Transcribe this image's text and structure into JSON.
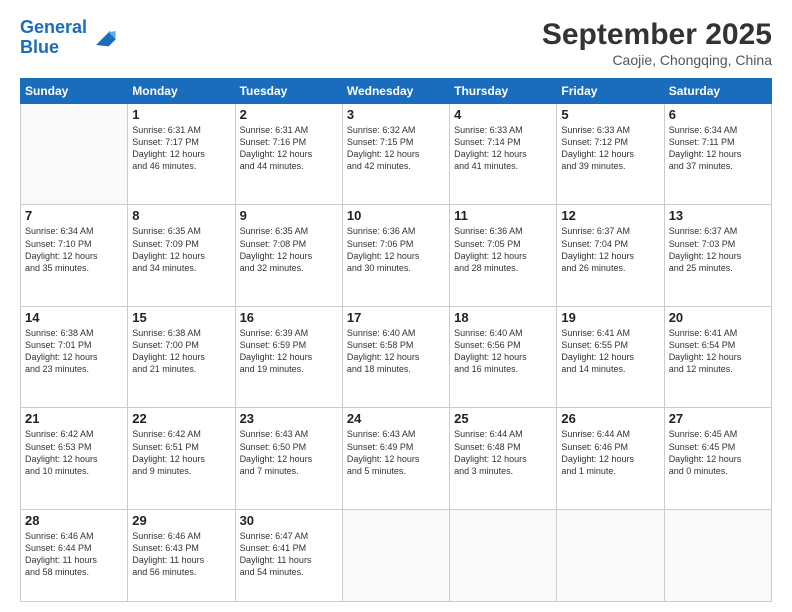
{
  "header": {
    "logo_line1": "General",
    "logo_line2": "Blue",
    "month": "September 2025",
    "location": "Caojie, Chongqing, China"
  },
  "weekdays": [
    "Sunday",
    "Monday",
    "Tuesday",
    "Wednesday",
    "Thursday",
    "Friday",
    "Saturday"
  ],
  "weeks": [
    [
      {
        "day": "",
        "info": ""
      },
      {
        "day": "1",
        "info": "Sunrise: 6:31 AM\nSunset: 7:17 PM\nDaylight: 12 hours\nand 46 minutes."
      },
      {
        "day": "2",
        "info": "Sunrise: 6:31 AM\nSunset: 7:16 PM\nDaylight: 12 hours\nand 44 minutes."
      },
      {
        "day": "3",
        "info": "Sunrise: 6:32 AM\nSunset: 7:15 PM\nDaylight: 12 hours\nand 42 minutes."
      },
      {
        "day": "4",
        "info": "Sunrise: 6:33 AM\nSunset: 7:14 PM\nDaylight: 12 hours\nand 41 minutes."
      },
      {
        "day": "5",
        "info": "Sunrise: 6:33 AM\nSunset: 7:12 PM\nDaylight: 12 hours\nand 39 minutes."
      },
      {
        "day": "6",
        "info": "Sunrise: 6:34 AM\nSunset: 7:11 PM\nDaylight: 12 hours\nand 37 minutes."
      }
    ],
    [
      {
        "day": "7",
        "info": "Sunrise: 6:34 AM\nSunset: 7:10 PM\nDaylight: 12 hours\nand 35 minutes."
      },
      {
        "day": "8",
        "info": "Sunrise: 6:35 AM\nSunset: 7:09 PM\nDaylight: 12 hours\nand 34 minutes."
      },
      {
        "day": "9",
        "info": "Sunrise: 6:35 AM\nSunset: 7:08 PM\nDaylight: 12 hours\nand 32 minutes."
      },
      {
        "day": "10",
        "info": "Sunrise: 6:36 AM\nSunset: 7:06 PM\nDaylight: 12 hours\nand 30 minutes."
      },
      {
        "day": "11",
        "info": "Sunrise: 6:36 AM\nSunset: 7:05 PM\nDaylight: 12 hours\nand 28 minutes."
      },
      {
        "day": "12",
        "info": "Sunrise: 6:37 AM\nSunset: 7:04 PM\nDaylight: 12 hours\nand 26 minutes."
      },
      {
        "day": "13",
        "info": "Sunrise: 6:37 AM\nSunset: 7:03 PM\nDaylight: 12 hours\nand 25 minutes."
      }
    ],
    [
      {
        "day": "14",
        "info": "Sunrise: 6:38 AM\nSunset: 7:01 PM\nDaylight: 12 hours\nand 23 minutes."
      },
      {
        "day": "15",
        "info": "Sunrise: 6:38 AM\nSunset: 7:00 PM\nDaylight: 12 hours\nand 21 minutes."
      },
      {
        "day": "16",
        "info": "Sunrise: 6:39 AM\nSunset: 6:59 PM\nDaylight: 12 hours\nand 19 minutes."
      },
      {
        "day": "17",
        "info": "Sunrise: 6:40 AM\nSunset: 6:58 PM\nDaylight: 12 hours\nand 18 minutes."
      },
      {
        "day": "18",
        "info": "Sunrise: 6:40 AM\nSunset: 6:56 PM\nDaylight: 12 hours\nand 16 minutes."
      },
      {
        "day": "19",
        "info": "Sunrise: 6:41 AM\nSunset: 6:55 PM\nDaylight: 12 hours\nand 14 minutes."
      },
      {
        "day": "20",
        "info": "Sunrise: 6:41 AM\nSunset: 6:54 PM\nDaylight: 12 hours\nand 12 minutes."
      }
    ],
    [
      {
        "day": "21",
        "info": "Sunrise: 6:42 AM\nSunset: 6:53 PM\nDaylight: 12 hours\nand 10 minutes."
      },
      {
        "day": "22",
        "info": "Sunrise: 6:42 AM\nSunset: 6:51 PM\nDaylight: 12 hours\nand 9 minutes."
      },
      {
        "day": "23",
        "info": "Sunrise: 6:43 AM\nSunset: 6:50 PM\nDaylight: 12 hours\nand 7 minutes."
      },
      {
        "day": "24",
        "info": "Sunrise: 6:43 AM\nSunset: 6:49 PM\nDaylight: 12 hours\nand 5 minutes."
      },
      {
        "day": "25",
        "info": "Sunrise: 6:44 AM\nSunset: 6:48 PM\nDaylight: 12 hours\nand 3 minutes."
      },
      {
        "day": "26",
        "info": "Sunrise: 6:44 AM\nSunset: 6:46 PM\nDaylight: 12 hours\nand 1 minute."
      },
      {
        "day": "27",
        "info": "Sunrise: 6:45 AM\nSunset: 6:45 PM\nDaylight: 12 hours\nand 0 minutes."
      }
    ],
    [
      {
        "day": "28",
        "info": "Sunrise: 6:46 AM\nSunset: 6:44 PM\nDaylight: 11 hours\nand 58 minutes."
      },
      {
        "day": "29",
        "info": "Sunrise: 6:46 AM\nSunset: 6:43 PM\nDaylight: 11 hours\nand 56 minutes."
      },
      {
        "day": "30",
        "info": "Sunrise: 6:47 AM\nSunset: 6:41 PM\nDaylight: 11 hours\nand 54 minutes."
      },
      {
        "day": "",
        "info": ""
      },
      {
        "day": "",
        "info": ""
      },
      {
        "day": "",
        "info": ""
      },
      {
        "day": "",
        "info": ""
      }
    ]
  ]
}
